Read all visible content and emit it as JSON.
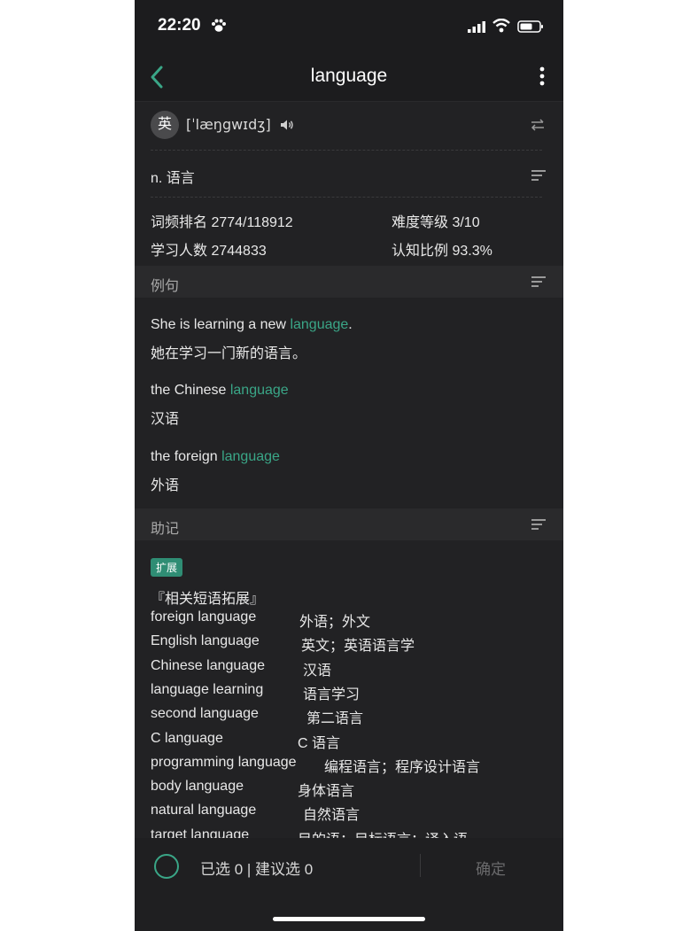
{
  "status": {
    "time": "22:20"
  },
  "nav": {
    "title": "language"
  },
  "pron": {
    "badge": "英",
    "ipa": "[ˈlæŋgwɪdʒ]"
  },
  "definition": "n. 语言",
  "stats": {
    "freq": "词频排名 2774/118912",
    "difficulty": "难度等级 3/10",
    "learners": "学习人数 2744833",
    "recognition": "认知比例 93.3%"
  },
  "examples": {
    "header": "例句",
    "items": [
      {
        "pre": "She is learning a new ",
        "word": "language",
        "post": ".",
        "cn": "她在学习一门新的语言。"
      },
      {
        "pre": "the Chinese ",
        "word": "language",
        "post": "",
        "cn": "汉语"
      },
      {
        "pre": "the foreign ",
        "word": "language",
        "post": "",
        "cn": "外语"
      }
    ]
  },
  "mnemonic": {
    "header": "助记",
    "badge": "扩展",
    "title": "『相关短语拓展』",
    "phrases": [
      {
        "en": "foreign language",
        "cn": "外语；外文"
      },
      {
        "en": "English language",
        "cn": "英文；英语语言学"
      },
      {
        "en": "Chinese language",
        "cn": "汉语"
      },
      {
        "en": "language learning",
        "cn": "语言学习"
      },
      {
        "en": "second language",
        "cn": "第二语言"
      },
      {
        "en": "C language",
        "cn": "C 语言"
      },
      {
        "en": "programming language",
        "cn": "编程语言；程序设计语言"
      },
      {
        "en": "body language",
        "cn": "身体语言"
      },
      {
        "en": "natural language",
        "cn": "自然语言"
      },
      {
        "en": "target language",
        "cn": "目的语；目标语言；译入语"
      }
    ]
  },
  "footer": {
    "selected": "已选 0 | 建议选 0",
    "confirm": "确定"
  },
  "colors": {
    "accent": "#3aa687",
    "bg": "#1c1c1e",
    "badge": "#2f8d74"
  }
}
